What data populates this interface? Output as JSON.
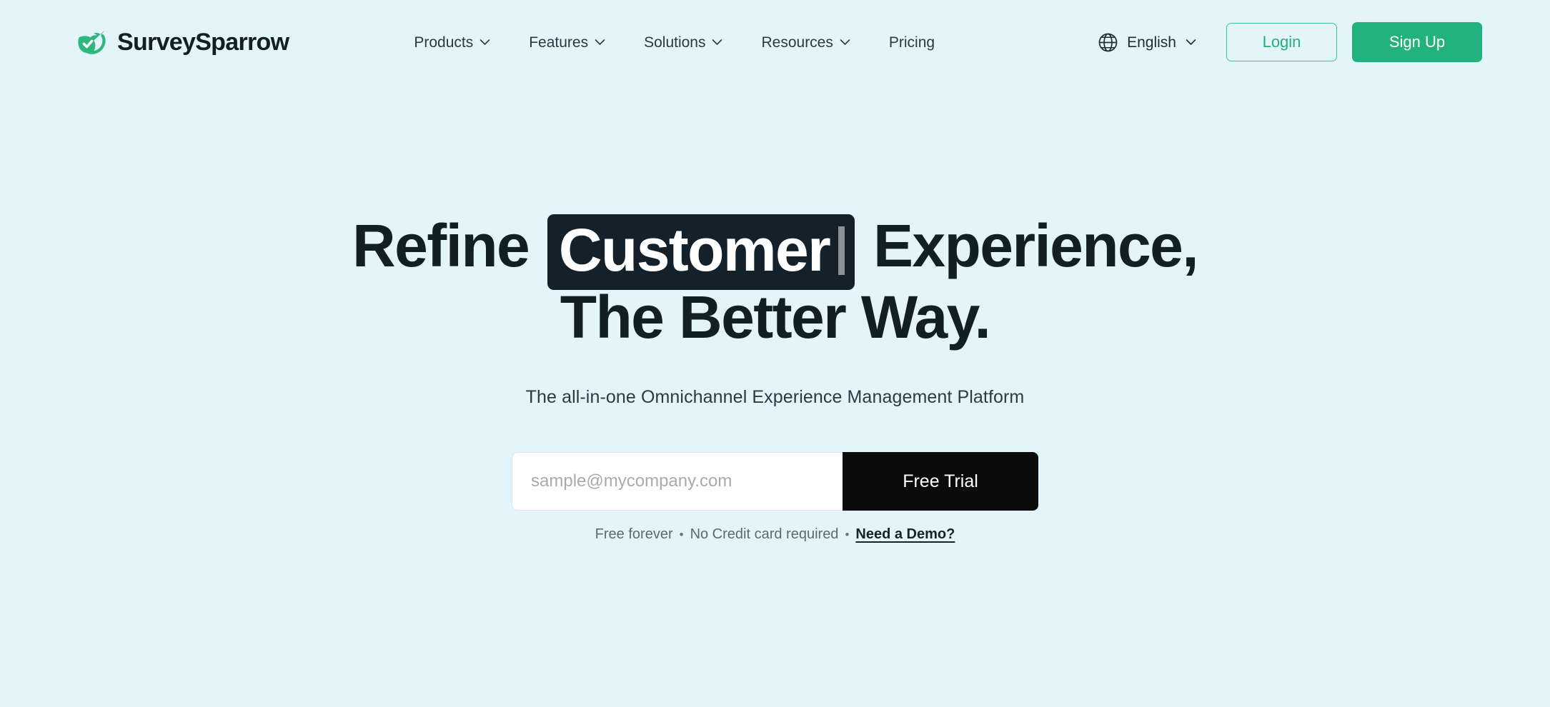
{
  "brand": {
    "name": "SurveySparrow",
    "logo_icon": "sparrow-leaf-check-logo",
    "accent_green": "#21b27d",
    "dark": "#14212a",
    "page_background": "#e3f4fa"
  },
  "nav": {
    "items": [
      {
        "label": "Products",
        "has_dropdown": true,
        "icon": "chevron-down-icon"
      },
      {
        "label": "Features",
        "has_dropdown": true,
        "icon": "chevron-down-icon"
      },
      {
        "label": "Solutions",
        "has_dropdown": true,
        "icon": "chevron-down-icon"
      },
      {
        "label": "Resources",
        "has_dropdown": true,
        "icon": "chevron-down-icon"
      },
      {
        "label": "Pricing",
        "has_dropdown": false,
        "icon": ""
      }
    ]
  },
  "header_actions": {
    "language": {
      "label": "English",
      "globe_icon": "globe-icon",
      "chevron_icon": "chevron-down-icon"
    },
    "login_label": "Login",
    "signup_label": "Sign Up"
  },
  "hero": {
    "headline_line1_prefix": "Refine",
    "headline_highlight": "Customer",
    "headline_line1_suffix": "Experience,",
    "headline_line2": "The Better Way.",
    "subheadline": "The all-in-one Omnichannel Experience Management Platform",
    "form": {
      "email_placeholder": "sample@mycompany.com",
      "email_value": "",
      "submit_label": "Free Trial"
    },
    "note": {
      "text_1": "Free forever",
      "separator_1": "•",
      "text_2": "No Credit card required",
      "separator_2": "•",
      "demo_link": "Need a Demo?"
    }
  }
}
